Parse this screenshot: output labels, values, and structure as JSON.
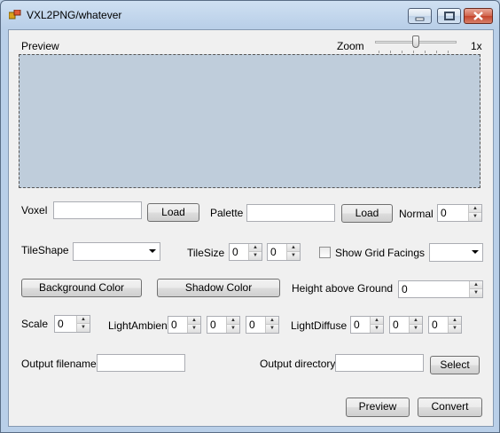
{
  "window": {
    "title": "VXL2PNG/whatever"
  },
  "preview": {
    "label": "Preview"
  },
  "zoom": {
    "label": "Zoom",
    "value_text": "1x",
    "level_fraction": 0.43
  },
  "voxel": {
    "label": "Voxel",
    "value": "",
    "load_label": "Load"
  },
  "palette": {
    "label": "Palette",
    "value": "",
    "load_label": "Load"
  },
  "normal": {
    "label": "Normal",
    "value": "0"
  },
  "tileshape": {
    "label": "TileShape",
    "selected": ""
  },
  "tilesize": {
    "label": "TileSize",
    "values": [
      "0",
      "0"
    ]
  },
  "show_grid": {
    "label": "Show Grid",
    "checked": false
  },
  "facings": {
    "label": "Facings",
    "selected": ""
  },
  "colors": {
    "background_label": "Background Color",
    "shadow_label": "Shadow Color"
  },
  "height_above_ground": {
    "label": "Height above Ground",
    "value": "0"
  },
  "scale": {
    "label": "Scale",
    "value": "0"
  },
  "light_ambient": {
    "label": "LightAmbient",
    "values": [
      "0",
      "0",
      "0"
    ]
  },
  "light_diffuse": {
    "label": "LightDiffuse",
    "values": [
      "0",
      "0",
      "0"
    ]
  },
  "output_filename": {
    "label": "Output filename",
    "value": ""
  },
  "output_directory": {
    "label": "Output directory",
    "value": "",
    "select_label": "Select"
  },
  "actions": {
    "preview_label": "Preview",
    "convert_label": "Convert"
  },
  "icons": {
    "app": "app-icon",
    "minimize": "minimize-icon",
    "maximize": "maximize-icon",
    "close": "close-icon"
  }
}
